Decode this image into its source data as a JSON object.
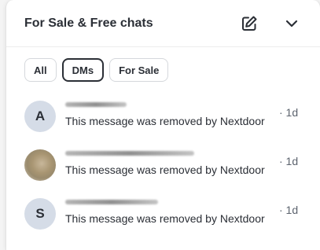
{
  "header": {
    "title": "For Sale & Free chats",
    "compose_icon": "compose-icon",
    "collapse_icon": "chevron-down-icon"
  },
  "filters": [
    {
      "label": "All",
      "active": false
    },
    {
      "label": "DMs",
      "active": true
    },
    {
      "label": "For Sale",
      "active": false
    }
  ],
  "conversations": [
    {
      "avatar_letter": "A",
      "avatar_type": "initial",
      "name": "",
      "preview": "This message was removed by Nextdoor",
      "time": "· 1d"
    },
    {
      "avatar_letter": "",
      "avatar_type": "photo",
      "name": "",
      "preview": "This message was removed by Nextdoor",
      "time": "· 1d"
    },
    {
      "avatar_letter": "S",
      "avatar_type": "initial",
      "name": "",
      "preview": "This message was removed by Nextdoor",
      "time": "· 1d"
    }
  ],
  "colors": {
    "text": "#2b2f36",
    "avatar_bg": "#d5dce7",
    "muted": "#5c636e"
  }
}
